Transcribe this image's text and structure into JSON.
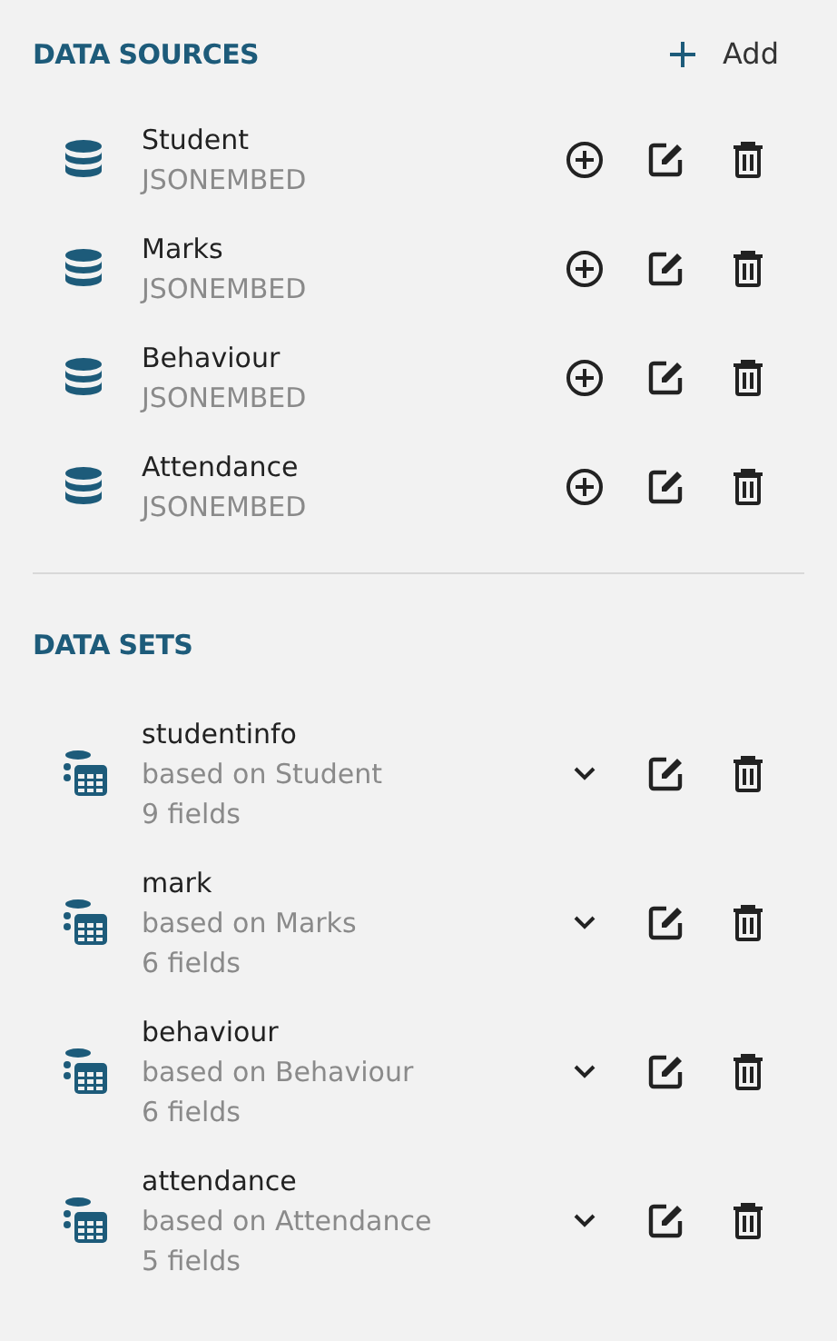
{
  "sources": {
    "title": "DATA SOURCES",
    "add_label": "Add",
    "items": [
      {
        "name": "Student",
        "type": "JSONEMBED"
      },
      {
        "name": "Marks",
        "type": "JSONEMBED"
      },
      {
        "name": "Behaviour",
        "type": "JSONEMBED"
      },
      {
        "name": "Attendance",
        "type": "JSONEMBED"
      }
    ]
  },
  "datasets": {
    "title": "DATA SETS",
    "items": [
      {
        "name": "studentinfo",
        "based_on": "based on Student",
        "fields": "9 fields",
        "expanded": false
      },
      {
        "name": "mark",
        "based_on": "based on Marks",
        "fields": "6 fields",
        "expanded": false
      },
      {
        "name": "behaviour",
        "based_on": "based on Behaviour",
        "fields": "6 fields",
        "expanded": false
      },
      {
        "name": "attendance",
        "based_on": "based on Attendance",
        "fields": "5 fields",
        "expanded": false
      }
    ]
  }
}
